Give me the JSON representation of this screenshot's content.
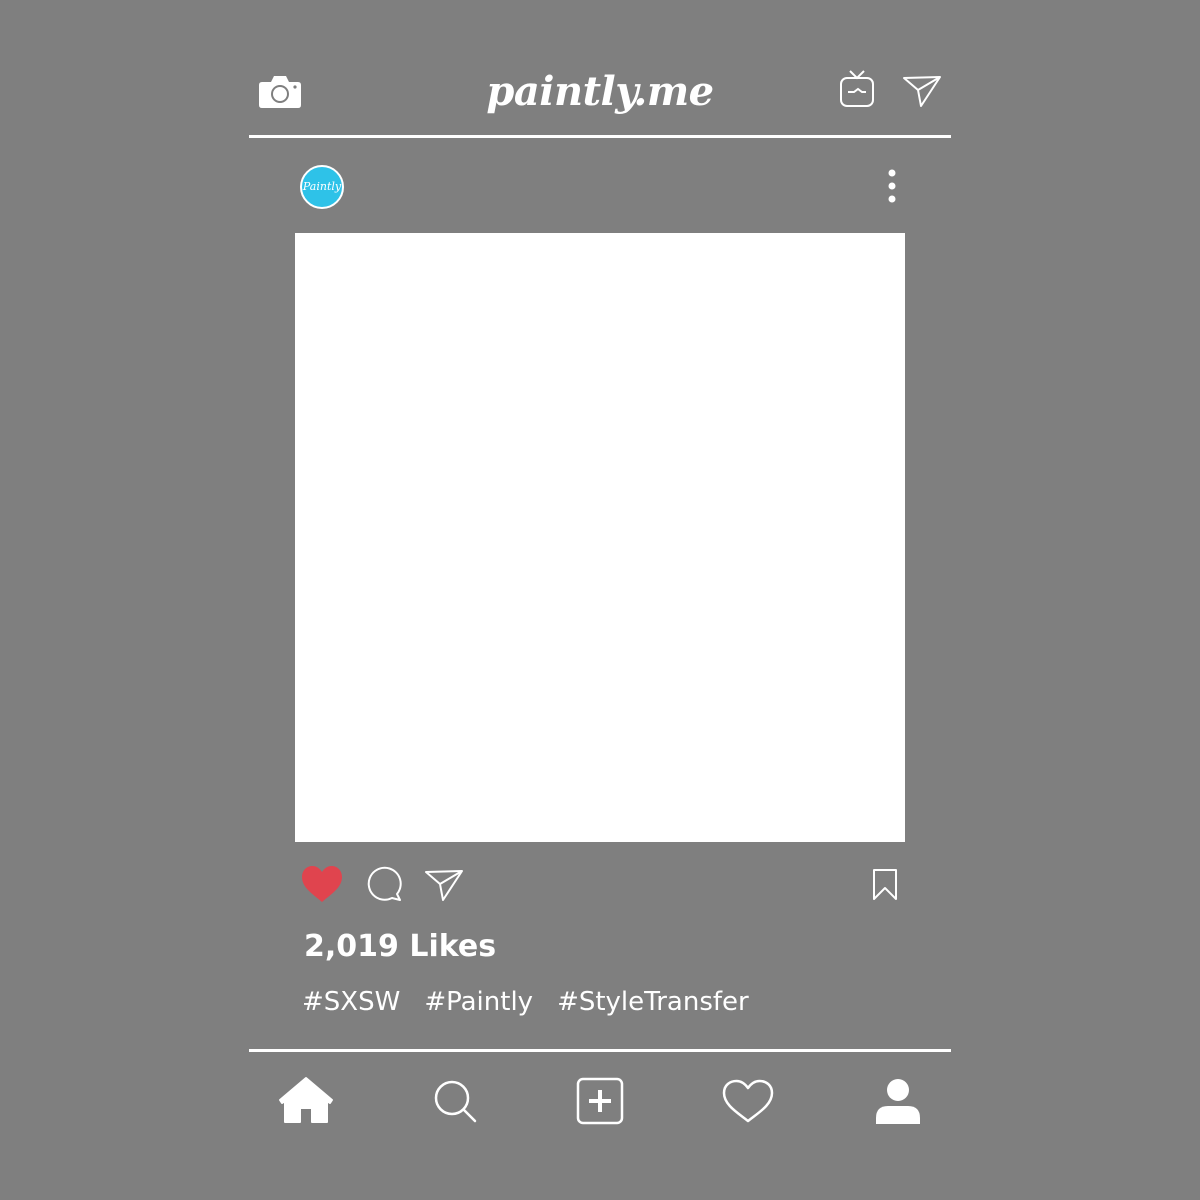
{
  "header": {
    "title": "paintly.me",
    "icons": [
      "camera-icon",
      "igtv-icon",
      "direct-message-icon"
    ]
  },
  "post": {
    "avatar_text": "Paintly",
    "avatar_color": "#2ec2e8",
    "menu_icon": "more-options-icon",
    "likes_text": "2,019 Likes",
    "hashtags": [
      "#SXSW",
      "#Paintly",
      "#StyleTransfer"
    ],
    "liked": true,
    "like_color": "#e0444e"
  },
  "action_bar": {
    "icons": [
      "like-heart-icon",
      "comment-icon",
      "share-icon",
      "bookmark-icon"
    ]
  },
  "bottom_nav": {
    "icons": [
      "home-icon",
      "search-icon",
      "add-post-icon",
      "activity-heart-icon",
      "profile-icon"
    ]
  },
  "colors": {
    "background": "#7f7f7f",
    "foreground": "#ffffff"
  }
}
